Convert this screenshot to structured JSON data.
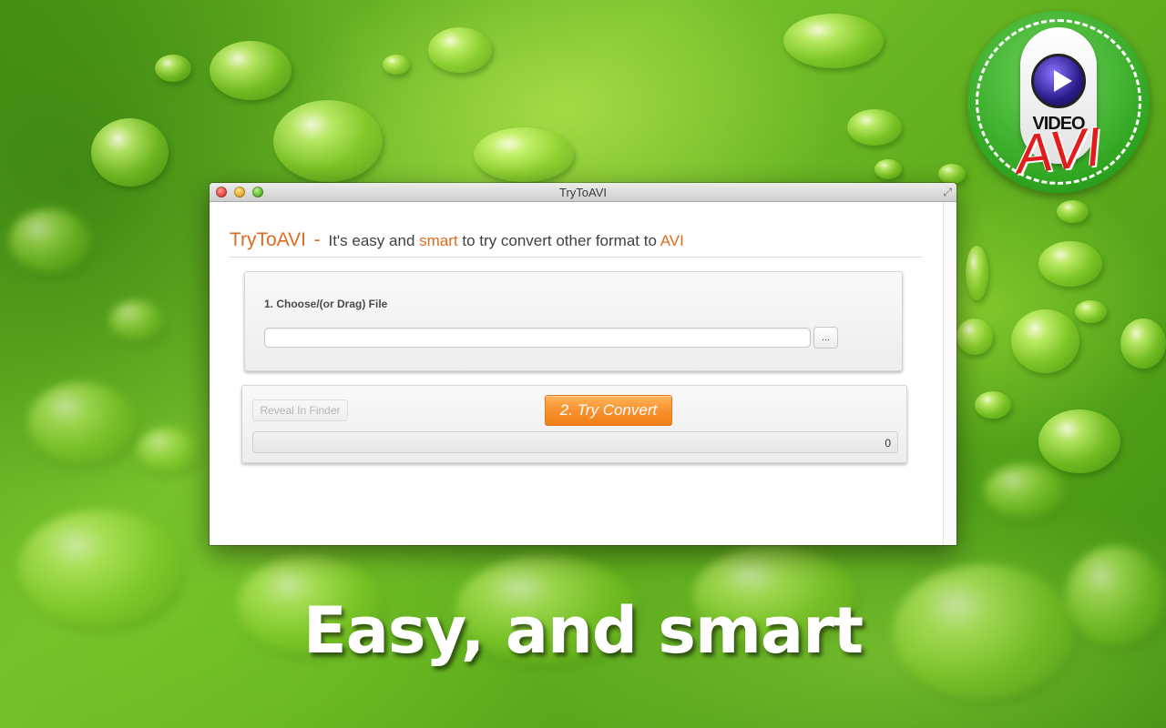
{
  "window": {
    "title": "TryToAVI"
  },
  "header": {
    "brand": "TryToAVI",
    "dash": "-",
    "text_part1": "It's easy and",
    "text_smart": "smart",
    "text_part2": "to try convert other format to",
    "text_avi": "AVI"
  },
  "step1": {
    "label": "1. Choose/(or Drag) File",
    "file_value": "",
    "browse_label": "..."
  },
  "step2": {
    "reveal_label": "Reveal In Finder",
    "convert_label": "2. Try Convert",
    "progress_value": "0",
    "progress_fraction": 0
  },
  "badge": {
    "video_text": "VIDEO",
    "avi_text": "AVI"
  },
  "tagline": "Easy, and smart",
  "colors": {
    "accent_orange": "#e06a1e",
    "button_orange": "#f7902b",
    "badge_green": "#2ea41f",
    "avi_red": "#e21b1b"
  },
  "icons": {
    "close": "close-dot-icon",
    "minimize": "minimize-dot-icon",
    "zoom": "zoom-dot-icon",
    "fullscreen": "fullscreen-arrows-icon",
    "play": "play-icon"
  }
}
